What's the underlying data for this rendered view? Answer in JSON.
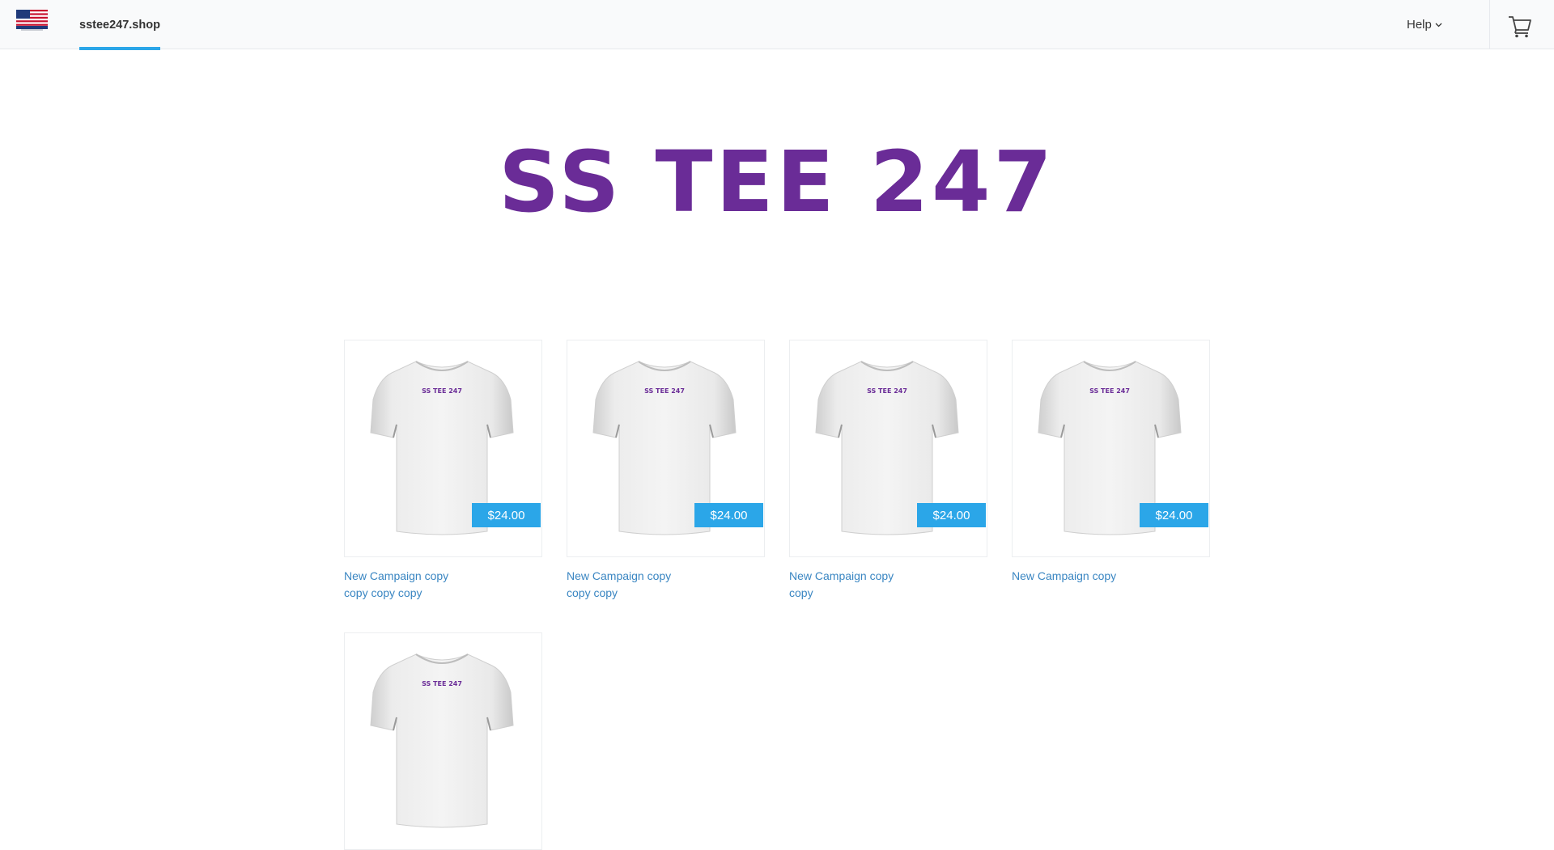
{
  "header": {
    "logo_icon": "usa-flag-made-in-usa-icon",
    "store_name": "sstee247.shop",
    "help_label": "Help",
    "cart_icon": "shopping-cart-icon",
    "accent_color": "#2ba6e8"
  },
  "hero": {
    "title": "SS TEE 247",
    "color": "#6a2c97"
  },
  "products": [
    {
      "title": "New Campaign copy copy copy copy",
      "price": "$24.00",
      "shirt_print": "SS TEE 247"
    },
    {
      "title": "New Campaign copy copy copy",
      "price": "$24.00",
      "shirt_print": "SS TEE 247"
    },
    {
      "title": "New Campaign copy copy",
      "price": "$24.00",
      "shirt_print": "SS TEE 247"
    },
    {
      "title": "New Campaign copy",
      "price": "$24.00",
      "shirt_print": "SS TEE 247"
    },
    {
      "title": "",
      "price": "",
      "shirt_print": "SS TEE 247"
    }
  ]
}
